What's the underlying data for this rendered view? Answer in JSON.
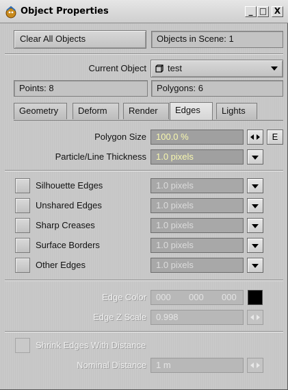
{
  "window": {
    "title": "Object Properties",
    "buttons": [
      "_",
      "□",
      "X"
    ]
  },
  "top": {
    "clear_all": "Clear All Objects",
    "objects_in_scene": "Objects in Scene: 1"
  },
  "object": {
    "label": "Current Object",
    "value": "test",
    "points": "Points: 8",
    "polygons": "Polygons: 6"
  },
  "tabs": [
    {
      "label": "Geometry",
      "active": false
    },
    {
      "label": "Deform",
      "active": false
    },
    {
      "label": "Render",
      "active": false
    },
    {
      "label": "Edges",
      "active": true
    },
    {
      "label": "Lights",
      "active": false
    }
  ],
  "size": {
    "polygon_label": "Polygon Size",
    "polygon_value": "100.0 %",
    "envelope": "E",
    "thickness_label": "Particle/Line Thickness",
    "thickness_value": "1.0 pixels"
  },
  "edges": [
    {
      "label": "Silhouette Edges",
      "value": "1.0 pixels"
    },
    {
      "label": "Unshared Edges",
      "value": "1.0 pixels"
    },
    {
      "label": "Sharp Creases",
      "value": "1.0 pixels"
    },
    {
      "label": "Surface Borders",
      "value": "1.0 pixels"
    },
    {
      "label": "Other Edges",
      "value": "1.0 pixels"
    }
  ],
  "color": {
    "label": "Edge Color",
    "r": "000",
    "g": "000",
    "b": "000",
    "swatch": "#000000",
    "z_label": "Edge Z Scale",
    "z_value": "0.998"
  },
  "shrink": {
    "label": "Shrink Edges With Distance",
    "nominal_label": "Nominal Distance",
    "nominal_value": "1 m"
  }
}
